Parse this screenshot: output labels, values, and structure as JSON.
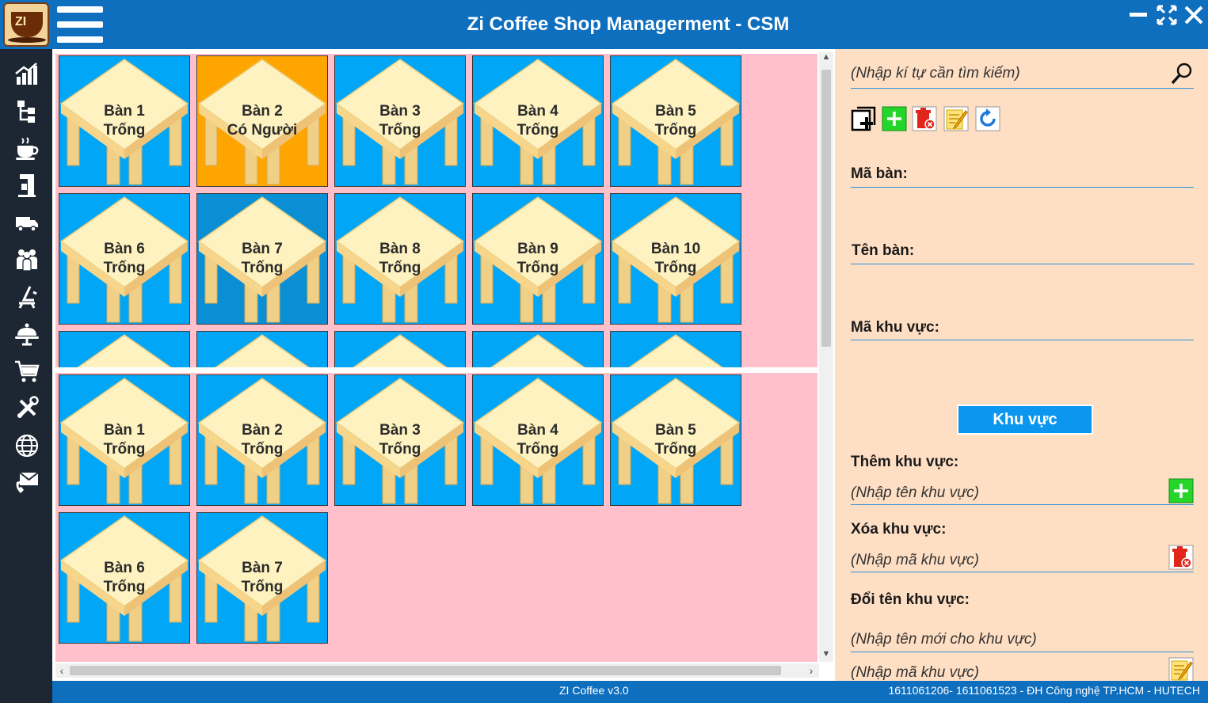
{
  "window": {
    "title": "Zi Coffee Shop Managerment - CSM",
    "logo_text": "ZI"
  },
  "sidebar": {
    "items": [
      {
        "icon": "statistics-icon"
      },
      {
        "icon": "hierarchy-icon"
      },
      {
        "icon": "coffee-cup-icon"
      },
      {
        "icon": "coffee-machine-icon"
      },
      {
        "icon": "delivery-truck-icon"
      },
      {
        "icon": "staff-icon"
      },
      {
        "icon": "lounge-chair-icon"
      },
      {
        "icon": "serving-tray-icon"
      },
      {
        "icon": "shopping-cart-icon"
      },
      {
        "icon": "tools-icon"
      },
      {
        "icon": "globe-icon"
      },
      {
        "icon": "contact-icon"
      }
    ]
  },
  "zones": [
    {
      "tables": [
        {
          "name": "Bàn 1",
          "status": "Trống",
          "state": "empty"
        },
        {
          "name": "Bàn 2",
          "status": "Có Người",
          "state": "occupied"
        },
        {
          "name": "Bàn 3",
          "status": "Trống",
          "state": "empty"
        },
        {
          "name": "Bàn 4",
          "status": "Trống",
          "state": "empty"
        },
        {
          "name": "Bàn 5",
          "status": "Trống",
          "state": "empty"
        },
        {
          "name": "Bàn 6",
          "status": "Trống",
          "state": "empty"
        },
        {
          "name": "Bàn 7",
          "status": "Trống",
          "state": "hover"
        },
        {
          "name": "Bàn 8",
          "status": "Trống",
          "state": "empty"
        },
        {
          "name": "Bàn 9",
          "status": "Trống",
          "state": "empty"
        },
        {
          "name": "Bàn 10",
          "status": "Trống",
          "state": "empty"
        },
        {
          "name": "",
          "status": "",
          "state": "empty"
        },
        {
          "name": "",
          "status": "",
          "state": "empty"
        },
        {
          "name": "",
          "status": "",
          "state": "empty"
        },
        {
          "name": "",
          "status": "",
          "state": "empty"
        },
        {
          "name": "",
          "status": "",
          "state": "empty"
        }
      ]
    },
    {
      "tables": [
        {
          "name": "Bàn 1",
          "status": "Trống",
          "state": "empty"
        },
        {
          "name": "Bàn 2",
          "status": "Trống",
          "state": "empty"
        },
        {
          "name": "Bàn 3",
          "status": "Trống",
          "state": "empty"
        },
        {
          "name": "Bàn 4",
          "status": "Trống",
          "state": "empty"
        },
        {
          "name": "Bàn 5",
          "status": "Trống",
          "state": "empty"
        },
        {
          "name": "Bàn 6",
          "status": "Trống",
          "state": "empty"
        },
        {
          "name": "Bàn 7",
          "status": "Trống",
          "state": "empty"
        }
      ]
    }
  ],
  "form": {
    "search_placeholder": "(Nhập kí tự cần tìm kiếm)",
    "toolbar_icons": [
      "add-table-icon",
      "add-icon",
      "delete-icon",
      "edit-icon",
      "refresh-icon"
    ],
    "table_id_label": "Mã bàn:",
    "table_id_value": "",
    "table_name_label": "Tên bàn:",
    "table_name_value": "",
    "zone_id_label": "Mã khu vực:",
    "zone_id_value": "",
    "zone_button": "Khu vực",
    "add_zone_label": "Thêm khu vực:",
    "add_zone_placeholder": "(Nhập tên khu vực)",
    "delete_zone_label": "Xóa khu vực:",
    "delete_zone_placeholder": "(Nhập mã khu vực)",
    "rename_zone_label": "Đổi tên khu vực:",
    "rename_zone_new_placeholder": "(Nhập tên mới cho khu vực)",
    "rename_zone_id_placeholder": "(Nhập mã khu vực)"
  },
  "status": {
    "version": "ZI Coffee v3.0",
    "credits": "1611061206- 1611061523 - ĐH Công nghệ TP.HCM - HUTECH"
  },
  "colors": {
    "titlebar": "#0f6fbf",
    "sidebar": "#1c2733",
    "table_empty": "#02a6f7",
    "table_occupied": "#ffa500",
    "zone_background": "#ffc0cb",
    "form_background": "#ffdfc4"
  }
}
